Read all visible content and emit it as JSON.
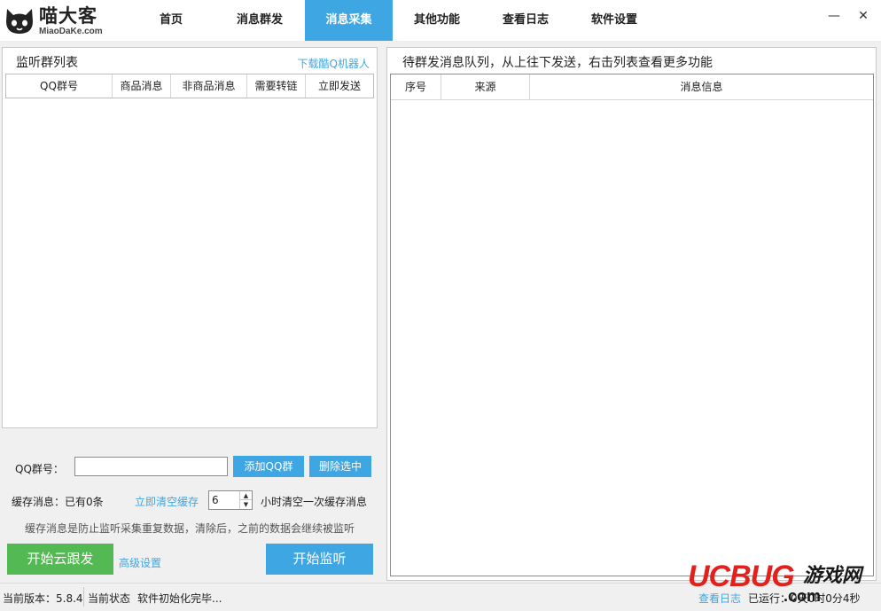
{
  "app": {
    "logo_title": "喵大客",
    "logo_sub": "MiaoDaKe.com"
  },
  "nav": [
    {
      "label": "首页"
    },
    {
      "label": "消息群发"
    },
    {
      "label": "消息采集"
    },
    {
      "label": "其他功能"
    },
    {
      "label": "查看日志"
    },
    {
      "label": "软件设置"
    }
  ],
  "window": {
    "minimize": "—",
    "close": "✕"
  },
  "left": {
    "title": "监听群列表",
    "download_link": "下载酷Q机器人",
    "columns": [
      "QQ群号",
      "商品消息",
      "非商品消息",
      "需要转链",
      "立即发送"
    ],
    "rows": []
  },
  "controls": {
    "qq_label": "QQ群号：",
    "qq_value": "",
    "add_button": "添加QQ群",
    "delete_button": "删除选中",
    "cache_label": "缓存消息：已有0条",
    "clear_cache_link": "立即清空缓存",
    "hours_value": "6",
    "hours_label": "小时清空一次缓存消息",
    "hint": "缓存消息是防止监听采集重复数据，清除后，之前的数据会继续被监听",
    "cloud_button": "开始云跟发",
    "advanced_link": "高级设置",
    "listen_button": "开始监听"
  },
  "right": {
    "title": "待群发消息队列，从上往下发送，右击列表查看更多功能",
    "columns": [
      "序号",
      "来源",
      "消息信息"
    ],
    "rows": []
  },
  "status": {
    "version": "当前版本：5.8.4",
    "state_label": "当前状态",
    "state_value": "软件初始化完毕...",
    "log_link": "查看日志",
    "runtime": "已运行：0天0时0分4秒"
  },
  "watermark": {
    "brand": "UCBUG",
    "game": "游戏网",
    "domain": ".com"
  },
  "colors": {
    "accent": "#3ea6e2",
    "green": "#53b953",
    "watermark_red": "#e2211c"
  }
}
